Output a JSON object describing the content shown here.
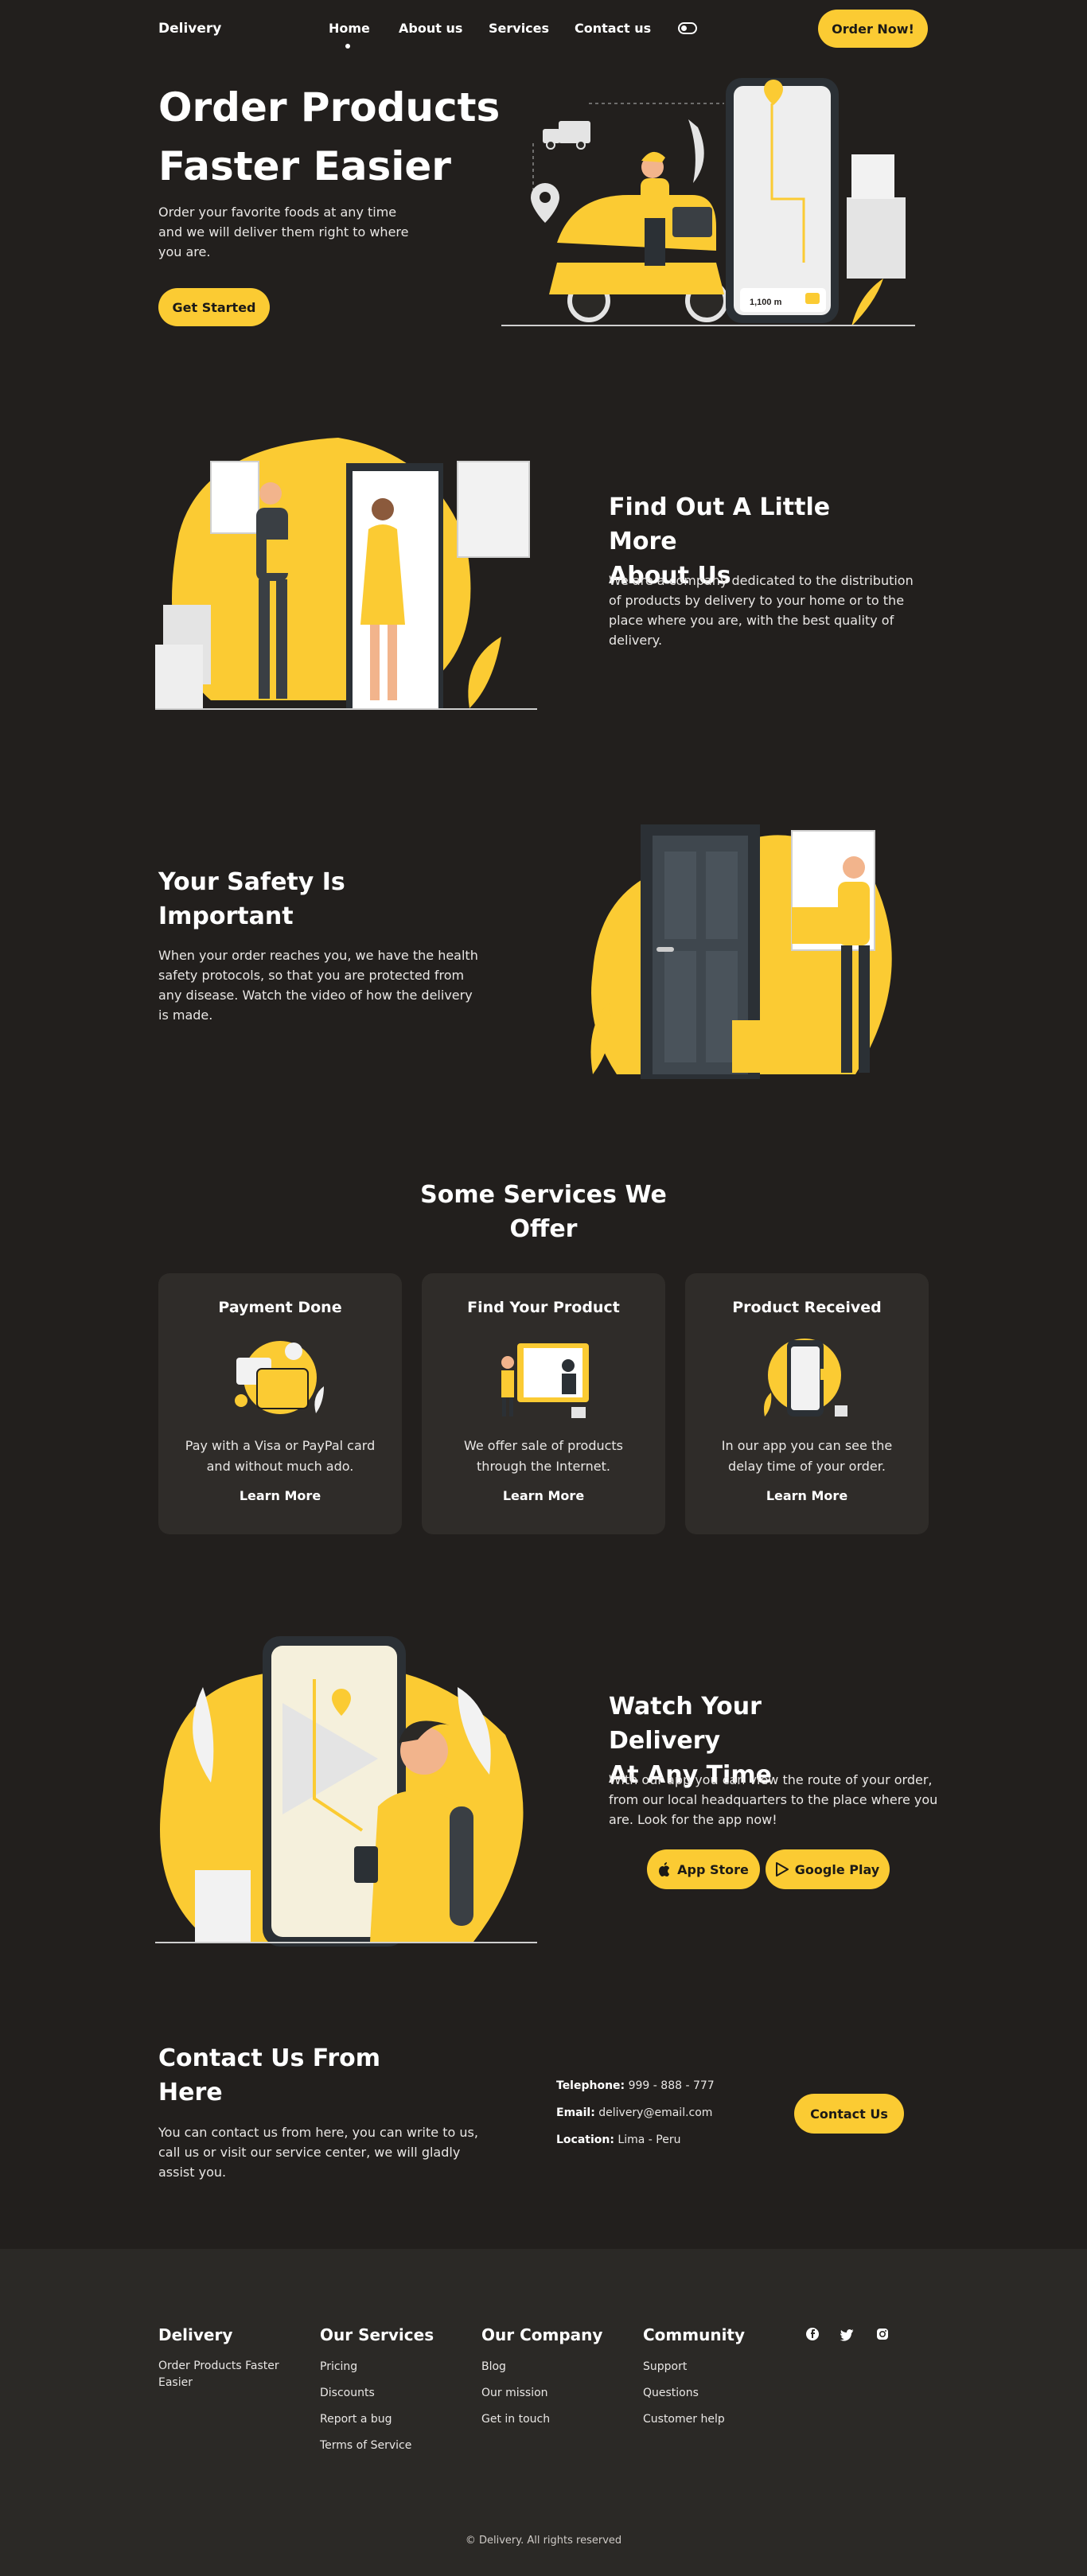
{
  "nav": {
    "logo": "Delivery",
    "links": [
      "Home",
      "About us",
      "Services",
      "Contact us"
    ],
    "order_button": "Order Now!"
  },
  "hero": {
    "title_line1": "Order Products",
    "title_line2": "Faster Easier",
    "text": "Order your favorite foods at any time and we will deliver them right to where you are.",
    "button": "Get Started",
    "phone_distance": "1,100 m"
  },
  "about": {
    "title_line1": "Find Out A Little More",
    "title_line2": "About Us",
    "text": "We are a company dedicated to the distribution of products by delivery to your home or to the place where you are, with the best quality of delivery."
  },
  "safety": {
    "title_line1": "Your Safety Is",
    "title_line2": "Important",
    "text": "When your order reaches you, we have the health safety protocols, so that you are protected from any disease. Watch the video of how the delivery is made."
  },
  "services": {
    "title_line1": "Some Services We",
    "title_line2": "Offer",
    "cards": [
      {
        "title": "Payment Done",
        "text": "Pay with a Visa or PayPal card and without much ado.",
        "link": "Learn More"
      },
      {
        "title": "Find Your Product",
        "text": "We offer sale of products through the Internet.",
        "link": "Learn More"
      },
      {
        "title": "Product Received",
        "text": "In our app you can see the delay time of your order.",
        "link": "Learn More"
      }
    ]
  },
  "watch": {
    "title_line1": "Watch Your Delivery",
    "title_line2": "At Any Time",
    "text": "With our app you can view the route of your order, from our local headquarters to the place where you are. Look for the app now!",
    "app_store": "App Store",
    "google_play": "Google Play"
  },
  "contact": {
    "title_line1": "Contact Us From",
    "title_line2": "Here",
    "text": "You can contact us from here, you can write to us, call us or visit our service center, we will gladly assist you.",
    "telephone_label": "Telephone:",
    "telephone": "999 - 888 - 777",
    "email_label": "Email:",
    "email": "delivery@email.com",
    "location_label": "Location:",
    "location": "Lima - Peru",
    "button": "Contact Us"
  },
  "footer": {
    "brand": "Delivery",
    "brand_text": "Order Products Faster Easier",
    "services_title": "Our Services",
    "services": [
      "Pricing",
      "Discounts",
      "Report a bug",
      "Terms of Service"
    ],
    "company_title": "Our Company",
    "company": [
      "Blog",
      "Our mission",
      "Get in touch"
    ],
    "community_title": "Community",
    "community": [
      "Support",
      "Questions",
      "Customer help"
    ],
    "copyright": "© Delivery. All rights reserved"
  },
  "colors": {
    "background": "#221f1d",
    "accent": "#fbcb33",
    "card": "#2f2c29",
    "footer": "#2b2926"
  }
}
